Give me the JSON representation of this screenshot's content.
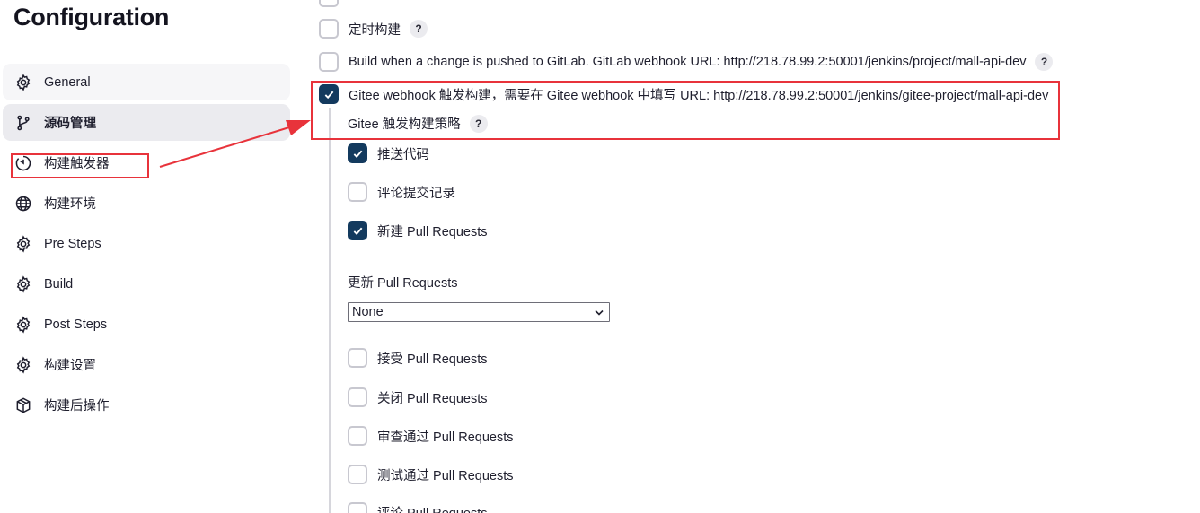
{
  "page": {
    "title": "Configuration"
  },
  "sidebar": {
    "items": [
      {
        "label": "General",
        "icon": "gear-icon"
      },
      {
        "label": "源码管理",
        "icon": "branch-icon"
      },
      {
        "label": "构建触发器",
        "icon": "timer-icon"
      },
      {
        "label": "构建环境",
        "icon": "globe-icon"
      },
      {
        "label": "Pre Steps",
        "icon": "gear-icon"
      },
      {
        "label": "Build",
        "icon": "gear-icon"
      },
      {
        "label": "Post Steps",
        "icon": "gear-icon"
      },
      {
        "label": "构建设置",
        "icon": "gear-icon"
      },
      {
        "label": "构建后操作",
        "icon": "package-icon"
      }
    ]
  },
  "triggers": {
    "timed_build": {
      "label": "定时构建",
      "checked": false
    },
    "gitlab": {
      "label": "Build when a change is pushed to GitLab. GitLab webhook URL: http://218.78.99.2:50001/jenkins/project/mall-api-dev",
      "checked": false
    },
    "gitee": {
      "label": "Gitee webhook 触发构建，需要在 Gitee webhook 中填写 URL: http://218.78.99.2:50001/jenkins/gitee-project/mall-api-dev",
      "checked": true
    },
    "gitee_strategy_label": "Gitee 触发构建策略",
    "help_label": "?"
  },
  "strategy": {
    "push_code": {
      "label": "推送代码",
      "checked": true
    },
    "comment_commit": {
      "label": "评论提交记录",
      "checked": false
    },
    "new_pr": {
      "label": "新建 Pull Requests",
      "checked": true
    },
    "update_pr_label": "更新 Pull Requests",
    "update_pr_select": "None",
    "accept_pr": {
      "label": "接受 Pull Requests",
      "checked": false
    },
    "close_pr": {
      "label": "关闭 Pull Requests",
      "checked": false
    },
    "review_pr": {
      "label": "审查通过 Pull Requests",
      "checked": false
    },
    "test_pr": {
      "label": "测试通过 Pull Requests",
      "checked": false
    },
    "comment_pr": {
      "label": "评论 Pull Requests",
      "checked": false
    }
  },
  "colors": {
    "accent": "#133a5e",
    "annotation": "#e8333b"
  }
}
